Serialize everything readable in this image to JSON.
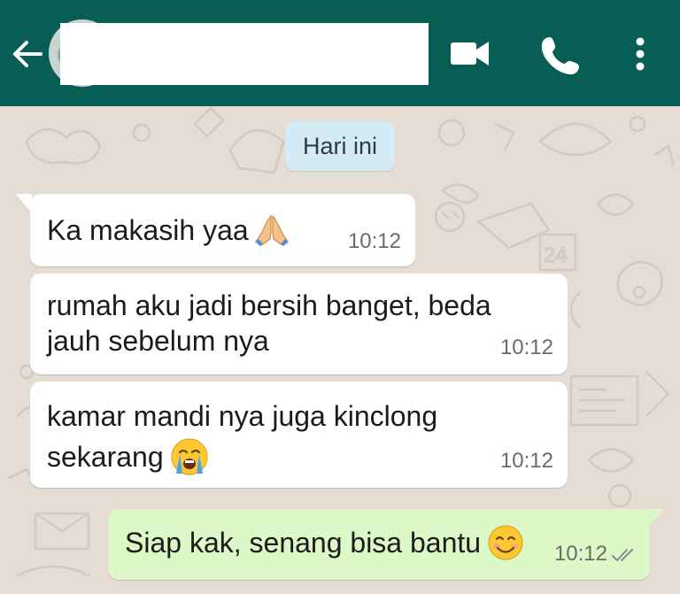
{
  "header": {
    "contact_name": "",
    "icons": {
      "back": "arrow-left-icon",
      "video": "video-camera-icon",
      "call": "phone-icon",
      "menu": "more-vert-icon"
    }
  },
  "date_chip": "Hari ini",
  "messages": [
    {
      "direction": "incoming",
      "lines": [
        "Ka makasih yaa"
      ],
      "emoji": "folded-hands-emoji",
      "time": "10:12"
    },
    {
      "direction": "incoming",
      "lines": [
        "rumah aku jadi bersih banget, beda",
        "jauh sebelum nya"
      ],
      "time": "10:12"
    },
    {
      "direction": "incoming",
      "lines": [
        "kamar mandi nya juga kinclong",
        "sekarang"
      ],
      "emoji": "loudly-crying-face-emoji",
      "time": "10:12"
    },
    {
      "direction": "outgoing",
      "lines": [
        "Siap kak, senang bisa bantu"
      ],
      "emoji": "smiling-face-emoji",
      "time": "10:12",
      "status": "read-double-tick-icon"
    }
  ],
  "colors": {
    "header": "#075e54",
    "background": "#e5ddd3",
    "incoming_bubble": "#ffffff",
    "outgoing_bubble": "#dcf8c6",
    "date_chip": "#d4eaf4",
    "read_ticks": "#8a8a8a"
  }
}
